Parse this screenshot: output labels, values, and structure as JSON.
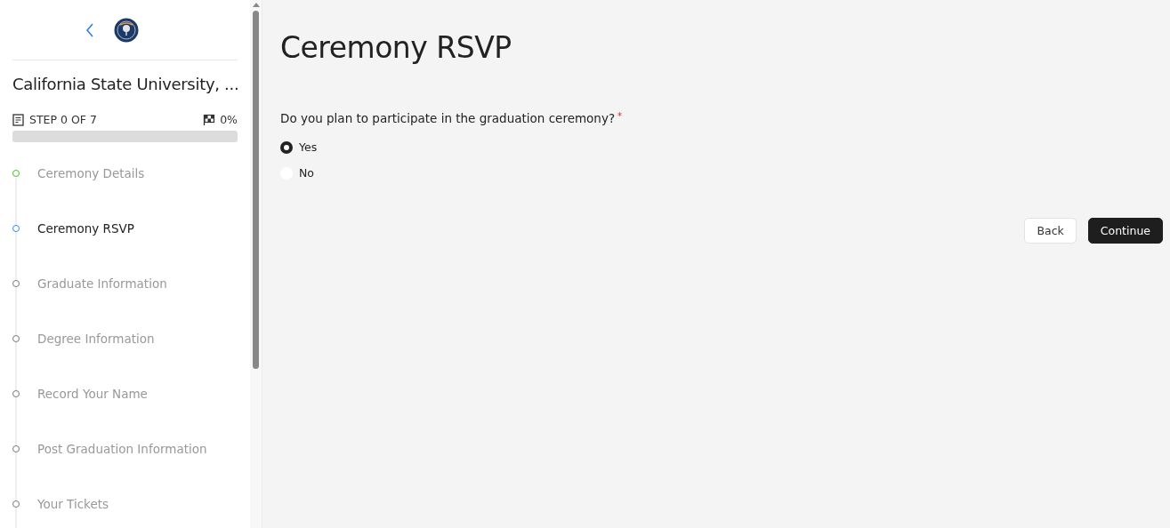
{
  "sidebar": {
    "school": "California State University, ...",
    "step_label": "STEP 0 OF 7",
    "percent": "0%",
    "progress": {
      "level": 0
    },
    "steps": [
      {
        "label": "Ceremony Details",
        "completed": true,
        "selected": false
      },
      {
        "label": "Ceremony RSVP",
        "completed": false,
        "selected": true
      },
      {
        "label": "Graduate Information",
        "completed": false,
        "selected": false
      },
      {
        "label": "Degree Information",
        "completed": false,
        "selected": false
      },
      {
        "label": "Record Your Name",
        "completed": false,
        "selected": false
      },
      {
        "label": "Post Graduation Information",
        "completed": false,
        "selected": false
      },
      {
        "label": "Your Tickets",
        "completed": false,
        "selected": false
      }
    ]
  },
  "main": {
    "title": "Ceremony RSVP",
    "question": "Do you plan to participate in the graduation ceremony?",
    "required_mark": "*",
    "options": [
      {
        "label": "Yes",
        "selected": true
      },
      {
        "label": "No",
        "selected": false
      }
    ],
    "buttons": [
      {
        "label": "Back",
        "kind": "secondary"
      },
      {
        "label": "Continue",
        "kind": "primary"
      }
    ]
  }
}
